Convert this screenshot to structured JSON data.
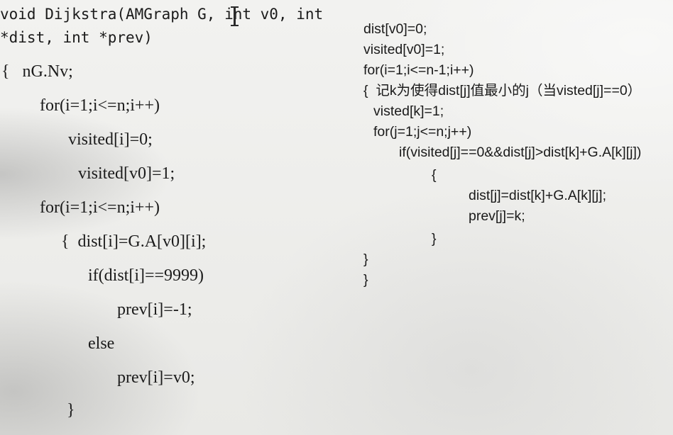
{
  "left_code": {
    "lines": [
      "void Dijkstra(AMGraph G, int v0, int",
      "*dist, int *prev)",
      "{   nG.Nv;",
      "for(i=1;i<=n;i++)",
      "visited[i]=0;",
      "visited[v0]=1;",
      "for(i=1;i<=n;i++)",
      "{  dist[i]=G.A[v0][i];",
      "if(dist[i]==9999)",
      "prev[i]=-1;",
      "else",
      "prev[i]=v0;",
      "}"
    ]
  },
  "right_code": {
    "lines": [
      "dist[v0]=0;",
      "visited[v0]=1;",
      "for(i=1;i<=n-1;i++)",
      "{  记k为使得dist[j]值最小的j（当visted[j]==0）",
      "visted[k]=1;",
      "for(j=1;j<=n;j++)",
      "if(visited[j]==0&&dist[j]>dist[k]+G.A[k][j])",
      "{",
      "dist[j]=dist[k]+G.A[k][j];",
      "prev[j]=k;",
      "}",
      "}",
      "}"
    ]
  }
}
